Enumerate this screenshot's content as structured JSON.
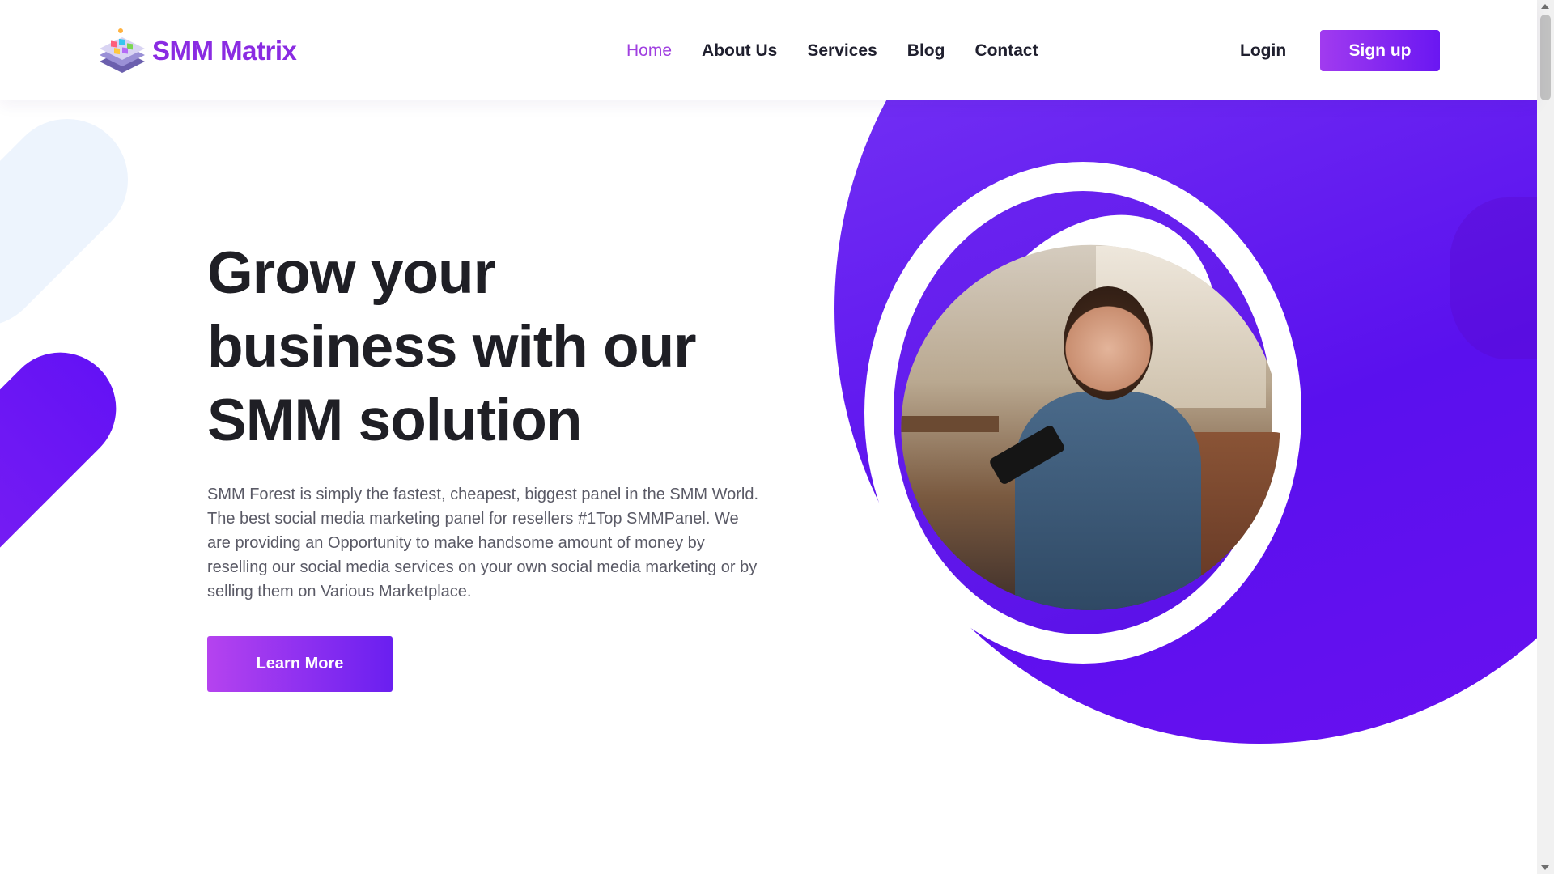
{
  "header": {
    "logo_text": "SMM Matrix",
    "logo_icon": "stacked-apps-icon",
    "nav": [
      {
        "label": "Home",
        "active": true
      },
      {
        "label": "About Us",
        "active": false
      },
      {
        "label": "Services",
        "active": false
      },
      {
        "label": "Blog",
        "active": false
      },
      {
        "label": "Contact",
        "active": false
      }
    ],
    "login_label": "Login",
    "signup_label": "Sign up"
  },
  "hero": {
    "title_lines": [
      "Grow your",
      "business with our",
      "SMM solution"
    ],
    "description": "SMM Forest is simply the fastest, cheapest, biggest panel in the SMM World. The best social media marketing panel for resellers #1Top SMMPanel. We are providing an Opportunity to make handsome amount of money by reselling our social media services on your own social media marketing or by selling them on Various Marketplace.",
    "cta_label": "Learn More",
    "image_subject": "smiling woman holding phone on sofa"
  },
  "colors": {
    "accent": "#8a2be2",
    "nav_active": "#a040e0",
    "hero_purple": "#5a10ee",
    "text_dark": "#1f1f25",
    "text_muted": "#5a5a66"
  }
}
